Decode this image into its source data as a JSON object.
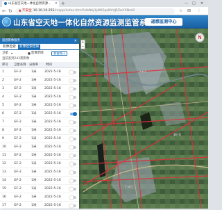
{
  "browser": {
    "tab_title": "山东省空天地一体化自然资源...",
    "new_tab": "+",
    "address_warning": "▲ 不安全",
    "address_host": "10.10.10.252",
    "address_path": "/rsapp/index.html?sfxNbj1jdWSqaNVdJ5ZwYXNzd2",
    "controls": {
      "minimize": "—",
      "maximize": "□",
      "close": "✕"
    }
  },
  "header": {
    "title": "山东省空天地一体化自然资源监测监管系统",
    "center_button": "遥感监测中心"
  },
  "panel": {
    "title": "遥感影像服务",
    "close": "✕",
    "tabs": [
      {
        "label": "影像检索",
        "active": false
      },
      {
        "label": "影像检索结果",
        "active": true
      }
    ],
    "filter": {
      "label1": "卫星",
      "label2": "影像范围",
      "button": "查看统计"
    },
    "subtitle": "当前查到243景影像",
    "columns": [
      "序号",
      "卫星名称",
      "分辨率",
      "时间",
      ""
    ],
    "rows": [
      {
        "num": "1",
        "sat": "GF-2",
        "res": "1米",
        "date": "2022-5-16",
        "on": false
      },
      {
        "num": "2",
        "sat": "GF-2",
        "res": "1米",
        "date": "2022-5-16",
        "on": false
      },
      {
        "num": "3",
        "sat": "GF-2",
        "res": "1米",
        "date": "2022-5-16",
        "on": false
      },
      {
        "num": "4",
        "sat": "GF-2",
        "res": "1米",
        "date": "2022-5-16",
        "on": false
      },
      {
        "num": "5",
        "sat": "GF-2",
        "res": "1米",
        "date": "2022-5-16",
        "on": false
      },
      {
        "num": "6",
        "sat": "GF-2",
        "res": "1米",
        "date": "2022-5-16",
        "on": true
      },
      {
        "num": "7",
        "sat": "GF-2",
        "res": "1米",
        "date": "2022-5-16",
        "on": false
      },
      {
        "num": "8",
        "sat": "GF-2",
        "res": "1米",
        "date": "2022-5-16",
        "on": false
      },
      {
        "num": "9",
        "sat": "GF-2",
        "res": "1米",
        "date": "2022-5-16",
        "on": false
      },
      {
        "num": "10",
        "sat": "GF-2",
        "res": "1米",
        "date": "2022-5-16",
        "on": false
      },
      {
        "num": "11",
        "sat": "GF-2",
        "res": "1米",
        "date": "2022-5-16",
        "on": false
      },
      {
        "num": "12",
        "sat": "GF-2",
        "res": "1米",
        "date": "2022-5-16",
        "on": false
      },
      {
        "num": "13",
        "sat": "GF-2",
        "res": "1米",
        "date": "2022-5-16",
        "on": false
      },
      {
        "num": "14",
        "sat": "GF-2",
        "res": "1米",
        "date": "2022-5-16",
        "on": false
      },
      {
        "num": "15",
        "sat": "GF-2",
        "res": "1米",
        "date": "2022-5-16",
        "on": false
      },
      {
        "num": "16",
        "sat": "GF-2",
        "res": "1米",
        "date": "2022-5-16",
        "on": false
      },
      {
        "num": "17",
        "sat": "GF-2",
        "res": "1米",
        "date": "2022-5-16",
        "on": false
      }
    ]
  },
  "map": {
    "zoom_in": "+",
    "zoom_out": "−",
    "compass": "N",
    "place_labels": [
      "济南市",
      "章丘区",
      "历城区"
    ]
  },
  "colors": {
    "header": "#1a5fa3",
    "accent": "#1d6fb8",
    "footprint": "#e0303a"
  }
}
